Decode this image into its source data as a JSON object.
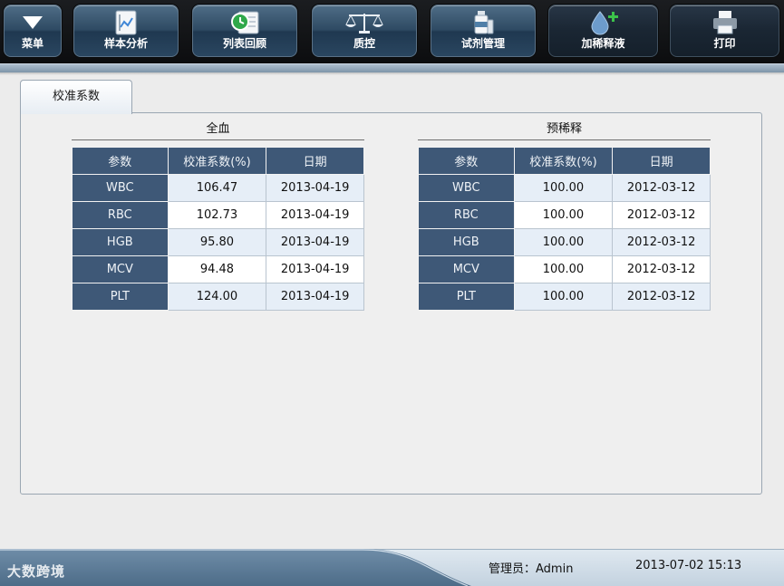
{
  "toolbar": {
    "menu": "菜单",
    "sample_analysis": "样本分析",
    "list_review": "列表回顾",
    "qc": "质控",
    "reagent_mgmt": "试剂管理",
    "dilute": "加稀释液",
    "print": "打印"
  },
  "tab": {
    "calibration_factor": "校准系数"
  },
  "whole_blood": {
    "title": "全血",
    "headers": [
      "参数",
      "校准系数(%)",
      "日期"
    ],
    "rows": [
      {
        "param": "WBC",
        "factor": "106.47",
        "date": "2013-04-19"
      },
      {
        "param": "RBC",
        "factor": "102.73",
        "date": "2013-04-19"
      },
      {
        "param": "HGB",
        "factor": "95.80",
        "date": "2013-04-19"
      },
      {
        "param": "MCV",
        "factor": "94.48",
        "date": "2013-04-19"
      },
      {
        "param": "PLT",
        "factor": "124.00",
        "date": "2013-04-19"
      }
    ]
  },
  "prediluted": {
    "title": "预稀释",
    "headers": [
      "参数",
      "校准系数(%)",
      "日期"
    ],
    "rows": [
      {
        "param": "WBC",
        "factor": "100.00",
        "date": "2012-03-12"
      },
      {
        "param": "RBC",
        "factor": "100.00",
        "date": "2012-03-12"
      },
      {
        "param": "HGB",
        "factor": "100.00",
        "date": "2012-03-12"
      },
      {
        "param": "MCV",
        "factor": "100.00",
        "date": "2012-03-12"
      },
      {
        "param": "PLT",
        "factor": "100.00",
        "date": "2012-03-12"
      }
    ]
  },
  "status": {
    "user": "管理员：Admin",
    "datetime": "2013-07-02 15:13"
  },
  "watermark": "大数跨境",
  "icons": {
    "menu": "triangle-down-icon",
    "sample_analysis": "chart-document-icon",
    "list_review": "clock-list-icon",
    "qc": "balance-scale-icon",
    "reagent_mgmt": "reagent-bottles-icon",
    "dilute": "droplet-plus-icon",
    "print": "printer-icon"
  },
  "colors": {
    "toolbar_bg": "#0c0d0f",
    "button_blue": "#2e4a63",
    "header_cell": "#3e5877",
    "row_alt": "#e6eef7",
    "accent_green": "#3cc24a"
  }
}
